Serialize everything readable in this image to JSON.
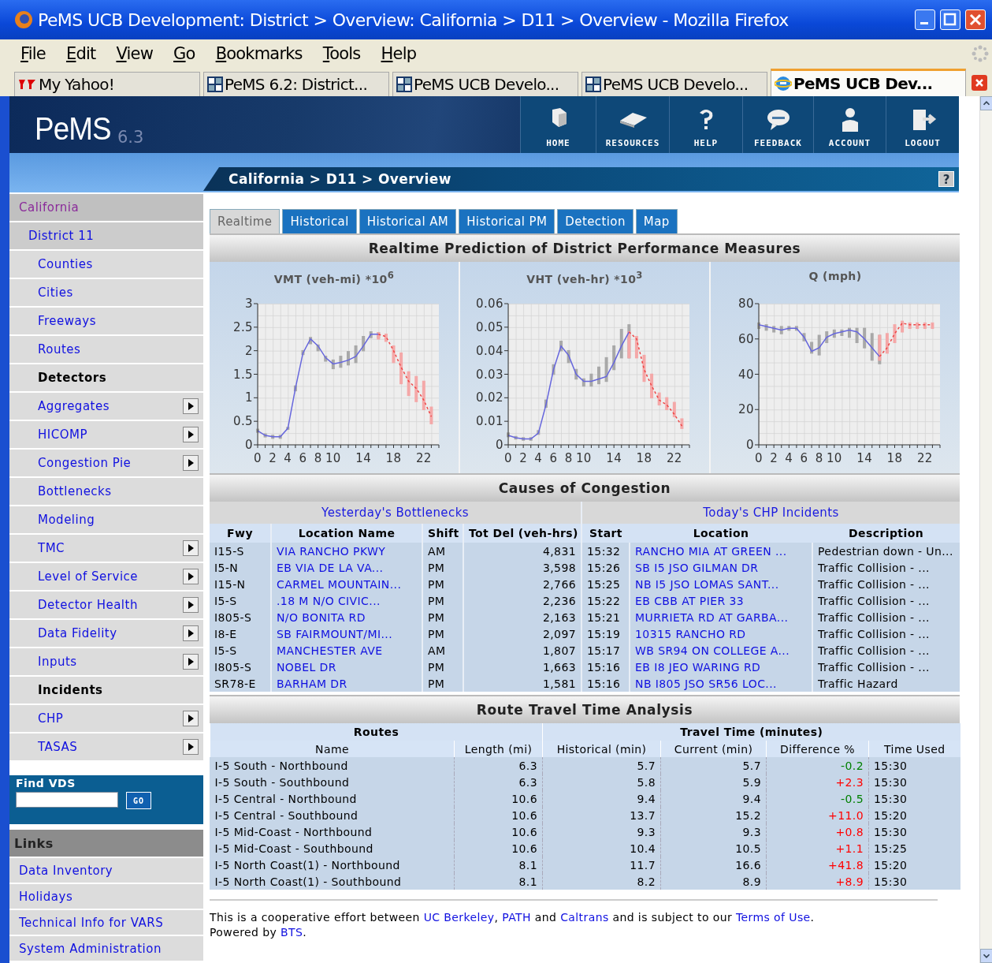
{
  "window": {
    "title": "PeMS UCB Development: District > Overview: California > D11 > Overview - Mozilla Firefox"
  },
  "menu": [
    "File",
    "Edit",
    "View",
    "Go",
    "Bookmarks",
    "Tools",
    "Help"
  ],
  "browser_tabs": [
    {
      "label": "My Yahoo!",
      "kind": "yahoo",
      "selected": false
    },
    {
      "label": "PeMS 6.2: District...",
      "kind": "pems",
      "selected": false
    },
    {
      "label": "PeMS UCB Develo...",
      "kind": "pems",
      "selected": false
    },
    {
      "label": "PeMS UCB Develo...",
      "kind": "pems",
      "selected": false
    },
    {
      "label": "PeMS UCB Dev...",
      "kind": "ie",
      "selected": true
    }
  ],
  "header": {
    "logo": "PeMS",
    "version": "6.3",
    "nav": [
      "HOME",
      "RESOURCES",
      "HELP",
      "FEEDBACK",
      "ACCOUNT",
      "LOGOUT"
    ],
    "breadcrumb": "California > D11 > Overview",
    "help": "?"
  },
  "sidebar": {
    "tree": [
      {
        "label": "California",
        "kind": "region",
        "children": [
          {
            "label": "District 11",
            "kind": "district",
            "children": [
              {
                "label": "Counties",
                "kind": "link",
                "submenu": false
              },
              {
                "label": "Cities",
                "kind": "link",
                "submenu": false
              },
              {
                "label": "Freeways",
                "kind": "link",
                "submenu": false
              },
              {
                "label": "Routes",
                "kind": "link",
                "submenu": false
              },
              {
                "label": "Detectors",
                "kind": "heading",
                "submenu": false
              },
              {
                "label": "Aggregates",
                "kind": "link",
                "submenu": true
              },
              {
                "label": "HICOMP",
                "kind": "link",
                "submenu": true
              },
              {
                "label": "Congestion Pie",
                "kind": "link",
                "submenu": true
              },
              {
                "label": "Bottlenecks",
                "kind": "link",
                "submenu": false
              },
              {
                "label": "Modeling",
                "kind": "link",
                "submenu": false
              },
              {
                "label": "TMC",
                "kind": "link",
                "submenu": true
              },
              {
                "label": "Level of Service",
                "kind": "link",
                "submenu": true
              },
              {
                "label": "Detector Health",
                "kind": "link",
                "submenu": true
              },
              {
                "label": "Data Fidelity",
                "kind": "link",
                "submenu": true
              },
              {
                "label": "Inputs",
                "kind": "link",
                "submenu": true
              },
              {
                "label": "Incidents",
                "kind": "heading",
                "submenu": false
              },
              {
                "label": "CHP",
                "kind": "link",
                "submenu": true
              },
              {
                "label": "TASAS",
                "kind": "link",
                "submenu": true
              }
            ]
          }
        ]
      }
    ],
    "find_vds": {
      "label": "Find VDS",
      "button": "GO"
    },
    "links": {
      "title": "Links",
      "items": [
        "Data Inventory",
        "Holidays",
        "Technical Info for VARS",
        "System Administration"
      ]
    }
  },
  "page_tabs": [
    {
      "label": "Realtime",
      "selected": true
    },
    {
      "label": "Historical",
      "selected": false
    },
    {
      "label": "Historical AM",
      "selected": false
    },
    {
      "label": "Historical PM",
      "selected": false
    },
    {
      "label": "Detection",
      "selected": false
    },
    {
      "label": "Map",
      "selected": false
    }
  ],
  "performance": {
    "title": "Realtime Prediction of District Performance Measures",
    "charts": [
      {
        "chart_data": {
          "type": "line",
          "title": "VMT (veh-mi) *10$^{6}$",
          "xlim": [
            0,
            24
          ],
          "ylim": [
            0,
            3
          ],
          "xticks": [
            0,
            2,
            4,
            6,
            8,
            10,
            14,
            18,
            22
          ],
          "yticks": [
            0,
            0.5,
            1,
            1.5,
            2,
            2.5,
            3
          ],
          "grid": true,
          "x": [
            0,
            1,
            2,
            3,
            4,
            5,
            6,
            7,
            8,
            9,
            10,
            11,
            12,
            13,
            14,
            15,
            16,
            17,
            18,
            19,
            20,
            21,
            22,
            23
          ],
          "series": [
            {
              "color": "#6666dd",
              "line_style": "solid",
              "values": [
                0.3,
                0.2,
                0.17,
                0.17,
                0.35,
                1.2,
                1.95,
                2.25,
                2.1,
                1.85,
                1.72,
                1.75,
                1.8,
                1.88,
                2.1,
                2.35,
                2.35,
                null,
                null,
                null,
                null,
                null,
                null,
                null
              ],
              "errors": [
                [
                  0.27,
                  0.33
                ],
                [
                  0.17,
                  0.23
                ],
                [
                  0.14,
                  0.2
                ],
                [
                  0.14,
                  0.2
                ],
                [
                  0.33,
                  0.37
                ],
                [
                  1.15,
                  1.25
                ],
                [
                  1.92,
                  2.0
                ],
                [
                  2.15,
                  2.28
                ],
                [
                  2.0,
                  2.12
                ],
                [
                  1.78,
                  1.88
                ],
                [
                  1.62,
                  1.8
                ],
                [
                  1.65,
                  1.88
                ],
                [
                  1.7,
                  1.98
                ],
                [
                  1.75,
                  2.1
                ],
                [
                  2.0,
                  2.3
                ],
                [
                  2.28,
                  2.4
                ],
                [
                  2.28,
                  2.38
                ],
                null,
                null,
                null,
                null,
                null,
                null,
                null
              ]
            },
            {
              "color": "#ee4444",
              "line_style": "dashed",
              "values": [
                null,
                null,
                null,
                null,
                null,
                null,
                null,
                null,
                null,
                null,
                null,
                null,
                null,
                null,
                null,
                null,
                2.35,
                2.3,
                2.0,
                1.65,
                1.35,
                1.2,
                0.95,
                0.6
              ],
              "errors": [
                null,
                null,
                null,
                null,
                null,
                null,
                null,
                null,
                null,
                null,
                null,
                null,
                null,
                null,
                null,
                null,
                [
                  2.25,
                  2.38
                ],
                [
                  2.2,
                  2.35
                ],
                [
                  1.75,
                  2.1
                ],
                [
                  1.3,
                  1.95
                ],
                [
                  1.05,
                  1.55
                ],
                [
                  0.92,
                  1.45
                ],
                [
                  0.75,
                  1.35
                ],
                [
                  0.45,
                  0.8
                ]
              ]
            }
          ]
        }
      },
      {
        "chart_data": {
          "type": "line",
          "title": "VHT (veh-hr) *10$^{3}$",
          "xlim": [
            0,
            24
          ],
          "ylim": [
            0,
            0.06
          ],
          "xticks": [
            0,
            2,
            4,
            6,
            8,
            10,
            14,
            18,
            22
          ],
          "yticks": [
            0,
            0.01,
            0.02,
            0.03,
            0.04,
            0.05,
            0.06
          ],
          "grid": true,
          "x": [
            0,
            1,
            2,
            3,
            4,
            5,
            6,
            7,
            8,
            9,
            10,
            11,
            12,
            13,
            14,
            15,
            16,
            17,
            18,
            19,
            20,
            21,
            22,
            23
          ],
          "series": [
            {
              "color": "#6666dd",
              "line_style": "solid",
              "values": [
                0.004,
                0.003,
                0.0025,
                0.0025,
                0.005,
                0.017,
                0.032,
                0.042,
                0.038,
                0.03,
                0.027,
                0.027,
                0.028,
                0.029,
                0.035,
                0.042,
                0.048,
                null,
                null,
                null,
                null,
                null,
                null,
                null
              ],
              "errors": [
                [
                  0.0035,
                  0.005
                ],
                [
                  0.0025,
                  0.0035
                ],
                [
                  0.002,
                  0.003
                ],
                [
                  0.002,
                  0.003
                ],
                [
                  0.0045,
                  0.006
                ],
                [
                  0.016,
                  0.019
                ],
                [
                  0.03,
                  0.034
                ],
                [
                  0.04,
                  0.044
                ],
                [
                  0.035,
                  0.04
                ],
                [
                  0.028,
                  0.032
                ],
                [
                  0.025,
                  0.028
                ],
                [
                  0.025,
                  0.03
                ],
                [
                  0.026,
                  0.033
                ],
                [
                  0.027,
                  0.037
                ],
                [
                  0.032,
                  0.042
                ],
                [
                  0.037,
                  0.049
                ],
                [
                  0.037,
                  0.051
                ],
                null,
                null,
                null,
                null,
                null,
                null,
                null
              ]
            },
            {
              "color": "#ee4444",
              "line_style": "dashed",
              "values": [
                null,
                null,
                null,
                null,
                null,
                null,
                null,
                null,
                null,
                null,
                null,
                null,
                null,
                null,
                null,
                null,
                0.048,
                0.045,
                0.032,
                0.025,
                0.019,
                0.017,
                0.013,
                0.008
              ],
              "errors": [
                null,
                null,
                null,
                null,
                null,
                null,
                null,
                null,
                null,
                null,
                null,
                null,
                null,
                null,
                null,
                null,
                [
                  0.037,
                  0.048
                ],
                [
                  0.037,
                  0.046
                ],
                [
                  0.027,
                  0.038
                ],
                [
                  0.02,
                  0.03
                ],
                [
                  0.017,
                  0.022
                ],
                [
                  0.015,
                  0.02
                ],
                [
                  0.012,
                  0.018
                ],
                [
                  0.007,
                  0.011
                ]
              ]
            }
          ]
        }
      },
      {
        "chart_data": {
          "type": "line",
          "title": "Q (mph)",
          "xlim": [
            0,
            24
          ],
          "ylim": [
            0,
            80
          ],
          "xticks": [
            0,
            2,
            4,
            6,
            8,
            10,
            14,
            18,
            22
          ],
          "yticks": [
            0,
            20,
            40,
            60,
            80
          ],
          "grid": true,
          "x": [
            0,
            1,
            2,
            3,
            4,
            5,
            6,
            7,
            8,
            9,
            10,
            11,
            12,
            13,
            14,
            15,
            16,
            17,
            18,
            19,
            20,
            21,
            22,
            23
          ],
          "series": [
            {
              "color": "#6666dd",
              "line_style": "solid",
              "values": [
                68,
                67,
                66,
                65,
                66,
                66,
                61,
                53,
                55,
                61,
                63,
                64,
                65,
                64,
                60,
                55,
                50,
                null,
                null,
                null,
                null,
                null,
                null,
                null
              ],
              "errors": [
                [
                  66,
                  69
                ],
                [
                  65,
                  68
                ],
                [
                  64,
                  67
                ],
                [
                  63,
                  67
                ],
                [
                  65,
                  67
                ],
                [
                  65,
                  67
                ],
                [
                  59,
                  63
                ],
                [
                  52,
                  58
                ],
                [
                  51,
                  62
                ],
                [
                  58,
                  64
                ],
                [
                  61,
                  65
                ],
                [
                  62,
                  65
                ],
                [
                  61,
                  66
                ],
                [
                  58,
                  66
                ],
                [
                  55,
                  66
                ],
                [
                  48,
                  63
                ],
                [
                  46,
                  62
                ],
                null,
                null,
                null,
                null,
                null,
                null,
                null
              ]
            },
            {
              "color": "#ee4444",
              "line_style": "dashed",
              "values": [
                null,
                null,
                null,
                null,
                null,
                null,
                null,
                null,
                null,
                null,
                null,
                null,
                null,
                null,
                null,
                null,
                50,
                55,
                63,
                69,
                68,
                68,
                68,
                68
              ],
              "errors": [
                null,
                null,
                null,
                null,
                null,
                null,
                null,
                null,
                null,
                null,
                null,
                null,
                null,
                null,
                null,
                null,
                [
                  48,
                  62
                ],
                [
                  52,
                  63
                ],
                [
                  58,
                  68
                ],
                [
                  64,
                  70
                ],
                [
                  66,
                  69
                ],
                [
                  66,
                  69
                ],
                [
                  66,
                  69
                ],
                [
                  66,
                  69
                ]
              ]
            }
          ]
        }
      }
    ]
  },
  "congestion": {
    "title": "Causes of Congestion",
    "bottlenecks": {
      "title": "Yesterday's Bottlenecks",
      "columns": [
        "Fwy",
        "Location Name",
        "Shift",
        "Tot Del (veh-hrs)"
      ],
      "rows": [
        [
          "I15-S",
          "VIA RANCHO PKWY",
          "AM",
          "4,831"
        ],
        [
          "I5-N",
          "EB VIA DE LA VA...",
          "PM",
          "3,598"
        ],
        [
          "I15-N",
          "CARMEL MOUNTAIN...",
          "PM",
          "2,766"
        ],
        [
          "I5-S",
          ".18 M N/O CIVIC...",
          "PM",
          "2,236"
        ],
        [
          "I805-S",
          "N/O BONITA RD",
          "PM",
          "2,163"
        ],
        [
          "I8-E",
          "SB FAIRMOUNT/MI...",
          "PM",
          "2,097"
        ],
        [
          "I5-S",
          "MANCHESTER AVE",
          "AM",
          "1,807"
        ],
        [
          "I805-S",
          "NOBEL DR",
          "PM",
          "1,663"
        ],
        [
          "SR78-E",
          "BARHAM DR",
          "PM",
          "1,581"
        ]
      ]
    },
    "incidents": {
      "title": "Today's CHP Incidents",
      "columns": [
        "Start",
        "Location",
        "Description"
      ],
      "rows": [
        [
          "15:32",
          "RANCHO MIA AT GREEN ...",
          "Pedestrian down - Un..."
        ],
        [
          "15:26",
          "SB I5 JSO GILMAN DR",
          "Traffic Collision - ..."
        ],
        [
          "15:25",
          "NB I5 JSO LOMAS SANT...",
          "Traffic Collision - ..."
        ],
        [
          "15:22",
          "EB CBB AT PIER 33",
          "Traffic Collision - ..."
        ],
        [
          "15:21",
          "MURRIETA RD AT GARBA...",
          "Traffic Collision - ..."
        ],
        [
          "15:19",
          "10315 RANCHO RD",
          "Traffic Collision - ..."
        ],
        [
          "15:17",
          "WB SR94 ON COLLEGE A...",
          "Traffic Collision - ..."
        ],
        [
          "15:16",
          "EB I8 JEO WARING RD",
          "Traffic Collision - ..."
        ],
        [
          "15:16",
          "NB I805 JSO SR56 LOC...",
          "Traffic Hazard"
        ]
      ]
    }
  },
  "travel_time": {
    "title": "Route Travel Time Analysis",
    "groups": [
      "Routes",
      "Travel Time (minutes)"
    ],
    "columns": [
      "Name",
      "Length (mi)",
      "Historical (min)",
      "Current (min)",
      "Difference %",
      "Time Used"
    ],
    "rows": [
      {
        "name": "I-5 South - Northbound",
        "length": "6.3",
        "historical": "5.7",
        "current": "5.7",
        "difference": "-0.2",
        "color": "#008000",
        "time_used": "15:30"
      },
      {
        "name": "I-5 South - Southbound",
        "length": "6.3",
        "historical": "5.8",
        "current": "5.9",
        "difference": "+2.3",
        "color": "#ff0000",
        "time_used": "15:30"
      },
      {
        "name": "I-5 Central - Northbound",
        "length": "10.6",
        "historical": "9.4",
        "current": "9.4",
        "difference": "-0.5",
        "color": "#008000",
        "time_used": "15:30"
      },
      {
        "name": "I-5 Central - Southbound",
        "length": "10.6",
        "historical": "13.7",
        "current": "15.2",
        "difference": "+11.0",
        "color": "#ff0000",
        "time_used": "15:20"
      },
      {
        "name": "I-5 Mid-Coast - Northbound",
        "length": "10.6",
        "historical": "9.3",
        "current": "9.3",
        "difference": "+0.8",
        "color": "#ff0000",
        "time_used": "15:30"
      },
      {
        "name": "I-5 Mid-Coast - Southbound",
        "length": "10.6",
        "historical": "10.4",
        "current": "10.5",
        "difference": "+1.1",
        "color": "#ff0000",
        "time_used": "15:25"
      },
      {
        "name": "I-5 North Coast(1) - Northbound",
        "length": "8.1",
        "historical": "11.7",
        "current": "16.6",
        "difference": "+41.8",
        "color": "#ff0000",
        "time_used": "15:20"
      },
      {
        "name": "I-5 North Coast(1) - Southbound",
        "length": "8.1",
        "historical": "8.2",
        "current": "8.9",
        "difference": "+8.9",
        "color": "#ff0000",
        "time_used": "15:30"
      }
    ]
  },
  "footer": {
    "lines": [
      [
        {
          "kind": "text",
          "text": "This is a cooperative effort between "
        },
        {
          "kind": "link",
          "text": "UC Berkeley"
        },
        {
          "kind": "text",
          "text": ", "
        },
        {
          "kind": "link",
          "text": "PATH"
        },
        {
          "kind": "text",
          "text": " and "
        },
        {
          "kind": "link",
          "text": "Caltrans"
        },
        {
          "kind": "text",
          "text": " and is subject to our "
        },
        {
          "kind": "link",
          "text": "Terms of Use"
        },
        {
          "kind": "text",
          "text": "."
        }
      ],
      [
        {
          "kind": "text",
          "text": "Powered by "
        },
        {
          "kind": "link",
          "text": "BTS"
        },
        {
          "kind": "text",
          "text": "."
        }
      ]
    ]
  }
}
